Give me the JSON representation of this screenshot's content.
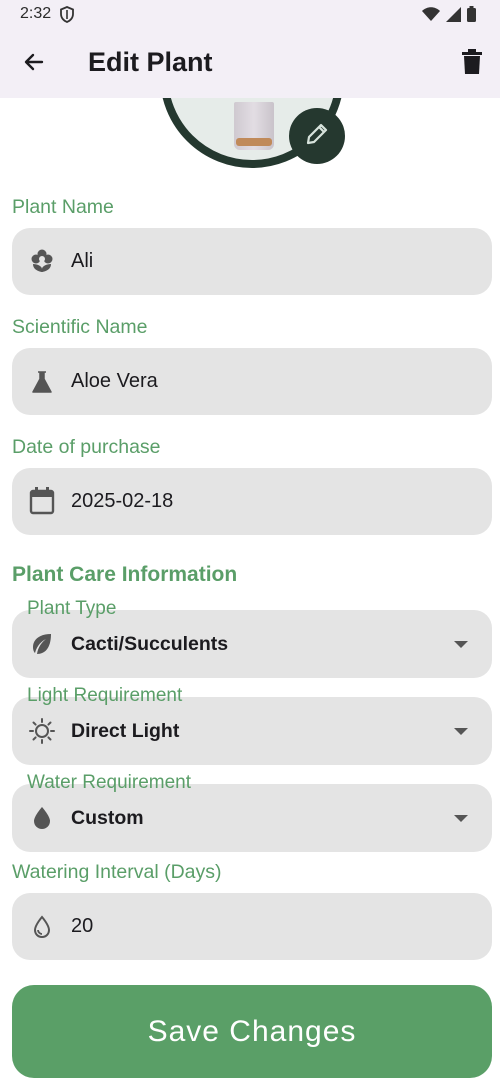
{
  "status_bar": {
    "time": "2:32"
  },
  "app_bar": {
    "title": "Edit Plant"
  },
  "fields": {
    "plant_name": {
      "label": "Plant Name",
      "value": "Ali"
    },
    "scientific_name": {
      "label": "Scientific Name",
      "value": "Aloe Vera"
    },
    "purchase_date": {
      "label": "Date of purchase",
      "value": "2025-02-18"
    }
  },
  "care_section": {
    "title": "Plant Care Information",
    "plant_type": {
      "label": "Plant Type",
      "value": "Cacti/Succulents"
    },
    "light": {
      "label": "Light Requirement",
      "value": "Direct Light"
    },
    "water": {
      "label": "Water Requirement",
      "value": "Custom"
    },
    "interval": {
      "label": "Watering Interval (Days)",
      "value": "20"
    }
  },
  "save_button": {
    "label": "Save Changes"
  },
  "colors": {
    "accent": "#5a9e68",
    "field_bg": "#e4e4e4",
    "app_bar_bg": "#f3eff6",
    "photo_ring": "#24382f"
  },
  "icons": [
    "back-arrow-icon",
    "trash-icon",
    "pencil-icon",
    "flower-icon",
    "flask-icon",
    "calendar-icon",
    "leaf-icon",
    "sun-icon",
    "water-drop-icon",
    "water-drop-outline-icon",
    "dropdown-caret-icon"
  ]
}
